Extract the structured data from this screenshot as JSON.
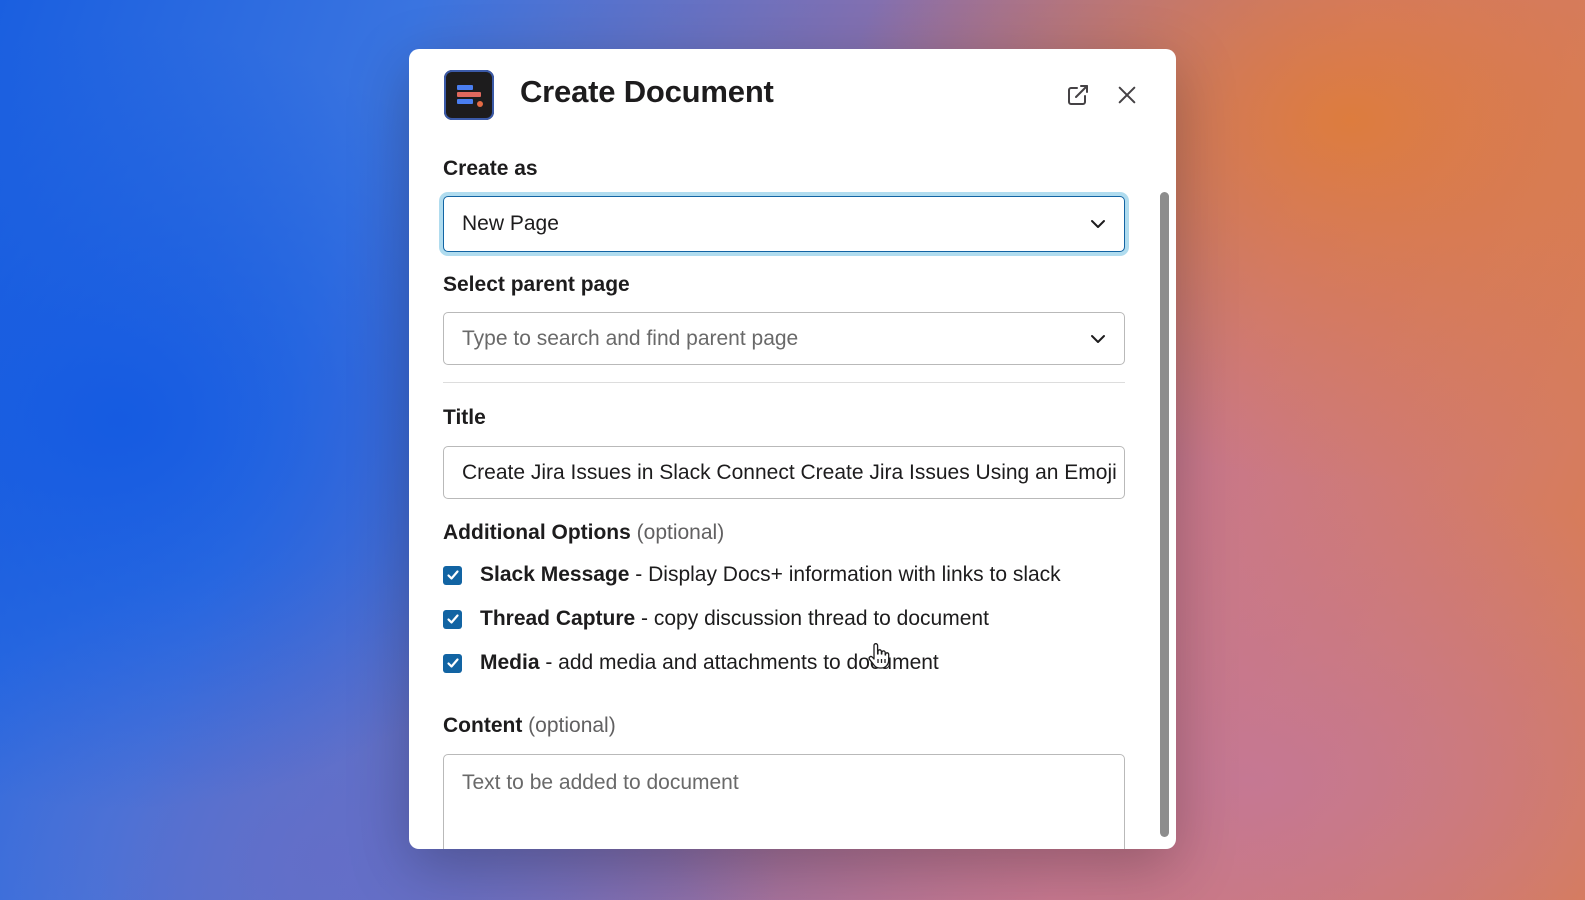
{
  "dialog": {
    "title": "Create Document",
    "open_in_new_window_icon": "external-link-icon",
    "close_icon": "close-icon",
    "app_icon": "docs-plus-logo"
  },
  "form": {
    "create_as": {
      "label": "Create as",
      "value": "New Page"
    },
    "parent_page": {
      "label": "Select parent page",
      "placeholder": "Type to search and find parent page"
    },
    "title": {
      "label": "Title",
      "value": "Create Jira Issues in Slack Connect Create Jira Issues Using an Emoji"
    },
    "additional_options": {
      "label": "Additional Options",
      "optional": "(optional)",
      "items": [
        {
          "name": "Slack Message",
          "description": "- Display Docs+ information with links to slack",
          "checked": true
        },
        {
          "name": "Thread Capture",
          "description": "- copy discussion thread to document",
          "checked": true
        },
        {
          "name": "Media",
          "description": "- add media and attachments to document",
          "checked": true
        }
      ]
    },
    "content": {
      "label": "Content",
      "optional": "(optional)",
      "placeholder": "Text to be added to document"
    }
  },
  "colors": {
    "accent": "#1264a3",
    "focus_ring": "#1d9bd1"
  }
}
